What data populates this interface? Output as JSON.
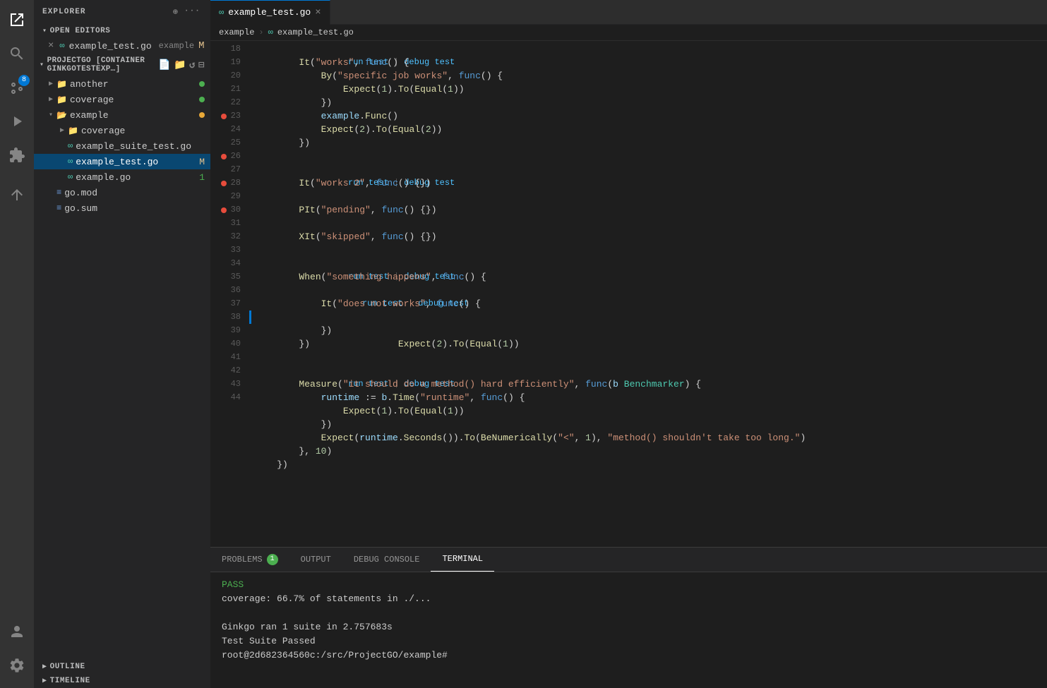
{
  "activityBar": {
    "icons": [
      {
        "name": "files-icon",
        "label": "Explorer",
        "active": true,
        "glyph": "☰"
      },
      {
        "name": "search-icon",
        "label": "Search",
        "active": false,
        "glyph": "🔍"
      },
      {
        "name": "source-control-icon",
        "label": "Source Control",
        "active": false,
        "glyph": "⎇",
        "badge": "8"
      },
      {
        "name": "run-icon",
        "label": "Run",
        "active": false,
        "glyph": "▷"
      },
      {
        "name": "extensions-icon",
        "label": "Extensions",
        "active": false,
        "glyph": "⊞"
      },
      {
        "name": "remote-icon",
        "label": "Remote Explorer",
        "active": false,
        "glyph": "⬡"
      }
    ],
    "bottomIcons": [
      {
        "name": "account-icon",
        "label": "Account",
        "glyph": "👤"
      },
      {
        "name": "settings-icon",
        "label": "Settings",
        "glyph": "⚙"
      }
    ]
  },
  "sidebar": {
    "title": "EXPLORER",
    "openEditors": {
      "label": "OPEN EDITORS",
      "items": [
        {
          "name": "example_test.go",
          "label": "example",
          "icon": "∞",
          "close": "×",
          "modified": "M"
        }
      ]
    },
    "project": {
      "label": "PROJECTGO [CONTAINER GINKGOTESTEXP…]",
      "tree": [
        {
          "indent": 1,
          "type": "folder",
          "name": "another",
          "dot": "green"
        },
        {
          "indent": 1,
          "type": "folder",
          "name": "coverage",
          "dot": "green"
        },
        {
          "indent": 1,
          "type": "folder-open",
          "name": "example",
          "dot": "orange"
        },
        {
          "indent": 2,
          "type": "folder",
          "name": "coverage"
        },
        {
          "indent": 2,
          "type": "file",
          "name": "example_suite_test.go",
          "icon": "∞"
        },
        {
          "indent": 2,
          "type": "file",
          "name": "example_test.go",
          "icon": "∞",
          "selected": true,
          "modified": "M"
        },
        {
          "indent": 2,
          "type": "file",
          "name": "example.go",
          "icon": "∞",
          "modified": "1"
        },
        {
          "indent": 1,
          "type": "file-mod",
          "name": "go.mod"
        },
        {
          "indent": 1,
          "type": "file-sum",
          "name": "go.sum"
        }
      ]
    },
    "outline": "OUTLINE",
    "timeline": "TIMELINE"
  },
  "tabs": [
    {
      "name": "example_test.go",
      "icon": "∞",
      "active": true,
      "close": "×"
    }
  ],
  "breadcrumb": {
    "parts": [
      "example",
      "example_test.go"
    ]
  },
  "code": {
    "lines": [
      {
        "num": 18,
        "content": "        It(\"works\", func() {"
      },
      {
        "num": 19,
        "content": "            By(\"specific job works\", func() {"
      },
      {
        "num": 20,
        "content": "                Expect(1).To(Equal(1))"
      },
      {
        "num": 21,
        "content": "            })"
      },
      {
        "num": 22,
        "content": "            example.Func()"
      },
      {
        "num": 23,
        "content": "            Expect(2).To(Equal(2))",
        "redDot": true
      },
      {
        "num": 24,
        "content": "        })"
      },
      {
        "num": 25,
        "content": ""
      },
      {
        "num": 26,
        "content": "        It(\"works 2\", func() {})",
        "redDot": true,
        "runDebug": true
      },
      {
        "num": 27,
        "content": ""
      },
      {
        "num": 28,
        "content": "        PIt(\"pending\", func() {})",
        "redDot": true
      },
      {
        "num": 29,
        "content": ""
      },
      {
        "num": 30,
        "content": "        XIt(\"skipped\", func() {})",
        "redDot": true
      },
      {
        "num": 31,
        "content": ""
      },
      {
        "num": 32,
        "content": "        When(\"something happens\", func() {",
        "runDebug": true
      },
      {
        "num": 33,
        "content": "            It(\"does not works\", func() {",
        "runDebug": true
      },
      {
        "num": 34,
        "content": "                Expect(2).To(Equal(1))",
        "leftBorder": true
      },
      {
        "num": 35,
        "content": "            })"
      },
      {
        "num": 36,
        "content": "        })"
      },
      {
        "num": 37,
        "content": ""
      },
      {
        "num": 38,
        "content": "        Measure(\"it should do a method() hard efficiently\", func(b Benchmarker) {",
        "runDebug": true
      },
      {
        "num": 39,
        "content": "            runtime := b.Time(\"runtime\", func() {"
      },
      {
        "num": 40,
        "content": "                Expect(1).To(Equal(1))"
      },
      {
        "num": 41,
        "content": "            })"
      },
      {
        "num": 42,
        "content": "            Expect(runtime.Seconds()).To(BeNumerically(\"<\", 1), \"method() shouldn't take too long.\")"
      },
      {
        "num": 43,
        "content": "        }, 10)"
      },
      {
        "num": 44,
        "content": "    })"
      }
    ]
  },
  "panel": {
    "tabs": [
      {
        "label": "PROBLEMS",
        "badge": "1",
        "active": false
      },
      {
        "label": "OUTPUT",
        "active": false
      },
      {
        "label": "DEBUG CONSOLE",
        "active": false
      },
      {
        "label": "TERMINAL",
        "active": true
      }
    ],
    "terminal": {
      "lines": [
        "PASS",
        "coverage: 66.7% of statements in ./...",
        "",
        "Ginkgo ran 1 suite in 2.757683s",
        "Test Suite Passed",
        "root@2d682364560c:/src/ProjectGO/example#"
      ]
    }
  },
  "runDebugLabel": "run test | debug test"
}
